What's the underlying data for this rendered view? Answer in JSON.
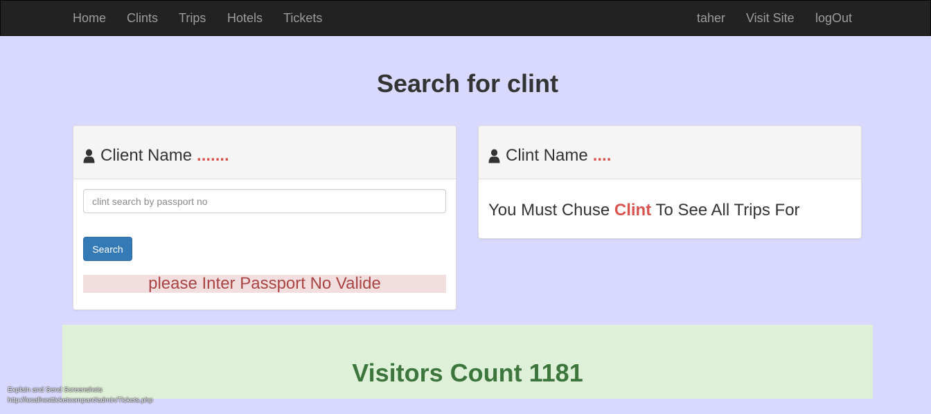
{
  "nav": {
    "left": [
      "Home",
      "Clints",
      "Trips",
      "Hotels",
      "Tickets"
    ],
    "right": [
      "taher",
      "Visit Site",
      "logOut"
    ]
  },
  "page_title": "Search for clint",
  "left_panel": {
    "heading": "Client Name",
    "heading_dots": ".......",
    "icon": "user-icon",
    "search_placeholder": "clint search by passport no",
    "search_value": "",
    "search_button": "Search",
    "error": "please Inter Passport No Valide"
  },
  "right_panel": {
    "heading": "Clint Name",
    "heading_dots": "....",
    "icon": "user-icon",
    "message_prefix": "You Must Chuse",
    "message_highlight": "Clint",
    "message_suffix": "To See All Trips For"
  },
  "visitors": "Visitors Count 1181",
  "overlay": {
    "line1": "Explain and Send Screenshots",
    "line2": "http://localhostticketcompant/admin/Tickets.php"
  },
  "colors": {
    "background": "#d9d9ff",
    "navbar": "#222222",
    "accent": "#d9534f",
    "button": "#337ab7",
    "success_bg": "#dff0d8",
    "success_text": "#3c763d",
    "danger_bg": "#f2dede",
    "danger_text": "#a94442"
  }
}
